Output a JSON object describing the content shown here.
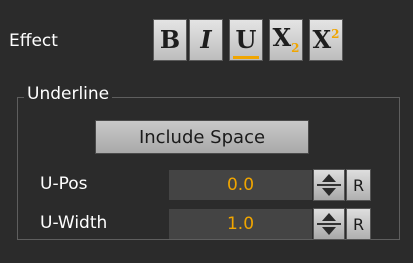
{
  "effect": {
    "label": "Effect",
    "buttons": {
      "bold": "B",
      "italic": "I",
      "underline": "U",
      "subscript_base": "X",
      "subscript_mark": "2",
      "superscript_base": "X",
      "superscript_mark": "2"
    }
  },
  "underline_group": {
    "title": "Underline",
    "include_space_label": "Include Space",
    "u_pos": {
      "label": "U-Pos",
      "value": "0.0",
      "reset_label": "R"
    },
    "u_width": {
      "label": "U-Width",
      "value": "1.0",
      "reset_label": "R"
    }
  },
  "colors": {
    "background": "#2b2b2b",
    "accent_orange": "#f0a500",
    "field_bg": "#444444"
  }
}
